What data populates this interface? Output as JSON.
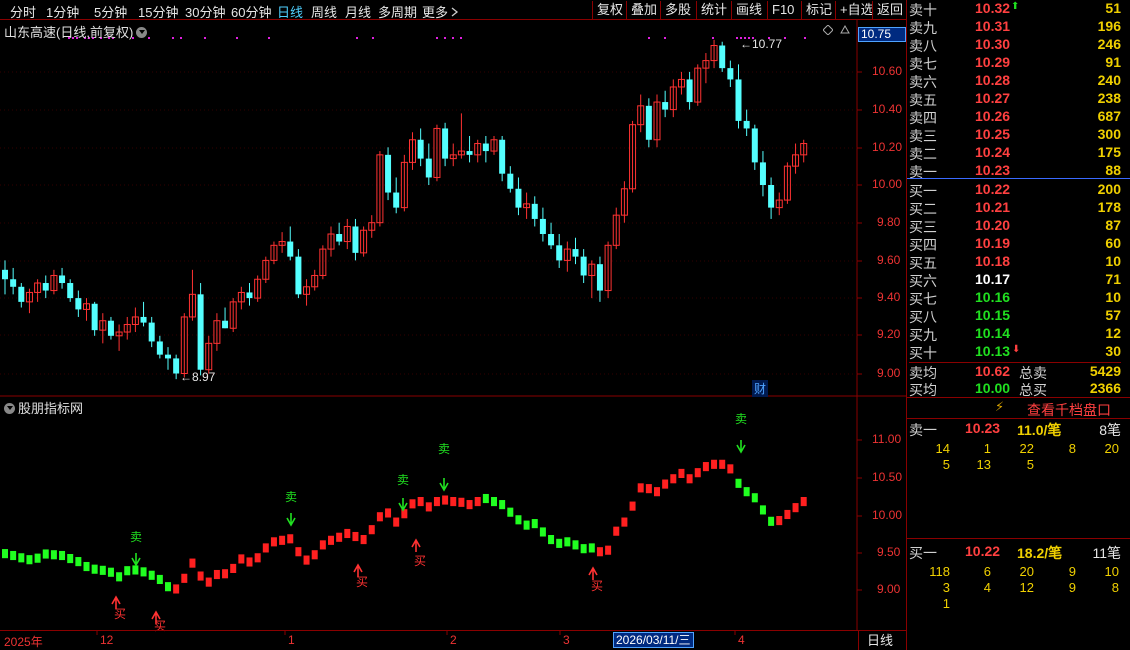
{
  "toolbar": {
    "periods": [
      {
        "label": "分时"
      },
      {
        "label": "1分钟"
      },
      {
        "label": "5分钟"
      },
      {
        "label": "15分钟"
      },
      {
        "label": "30分钟"
      },
      {
        "label": "60分钟"
      },
      {
        "label": "日线",
        "active": true
      },
      {
        "label": "周线"
      },
      {
        "label": "月线"
      },
      {
        "label": "多周期"
      },
      {
        "label": "更多"
      }
    ],
    "more_icon": "chevron-right-icon",
    "right_buttons": [
      {
        "label": "复权"
      },
      {
        "label": "叠加"
      },
      {
        "label": "多股"
      },
      {
        "label": "统计"
      },
      {
        "label": "画线"
      },
      {
        "label": "F10"
      },
      {
        "label": "标记"
      },
      {
        "label": "+自选"
      },
      {
        "label": "返回"
      }
    ]
  },
  "main_chart": {
    "title": "山东高速(日线,前复权)",
    "current_price_tag": "10.75",
    "y_ticks": [
      "10.60",
      "10.40",
      "10.20",
      "10.00",
      "9.80",
      "9.60",
      "9.40",
      "9.20",
      "9.00"
    ],
    "high_annotation": "10.77",
    "low_annotation": "8.97",
    "fin_marker": "财",
    "diamond_icon": "diamond-icon"
  },
  "indicator": {
    "title": "股朋指标网",
    "y_ticks": [
      "11.00",
      "10.50",
      "10.00",
      "9.50",
      "9.00"
    ],
    "sell_label": "卖",
    "buy_label": "买"
  },
  "date_axis": {
    "labels": [
      "2025年",
      "12",
      "1",
      "2",
      "3",
      "4"
    ],
    "highlight": "2026/03/11/三",
    "period": "日线"
  },
  "orderbook": {
    "asks": [
      {
        "label": "卖十",
        "price": "10.32",
        "vol": "51"
      },
      {
        "label": "卖九",
        "price": "10.31",
        "vol": "196"
      },
      {
        "label": "卖八",
        "price": "10.30",
        "vol": "246"
      },
      {
        "label": "卖七",
        "price": "10.29",
        "vol": "91"
      },
      {
        "label": "卖六",
        "price": "10.28",
        "vol": "240"
      },
      {
        "label": "卖五",
        "price": "10.27",
        "vol": "238"
      },
      {
        "label": "卖四",
        "price": "10.26",
        "vol": "687"
      },
      {
        "label": "卖三",
        "price": "10.25",
        "vol": "300"
      },
      {
        "label": "卖二",
        "price": "10.24",
        "vol": "175"
      },
      {
        "label": "卖一",
        "price": "10.23",
        "vol": "88"
      }
    ],
    "bids": [
      {
        "label": "买一",
        "price": "10.22",
        "vol": "200"
      },
      {
        "label": "买二",
        "price": "10.21",
        "vol": "178"
      },
      {
        "label": "买三",
        "price": "10.20",
        "vol": "87"
      },
      {
        "label": "买四",
        "price": "10.19",
        "vol": "60"
      },
      {
        "label": "买五",
        "price": "10.18",
        "vol": "10"
      },
      {
        "label": "买六",
        "price": "10.17",
        "vol": "71"
      },
      {
        "label": "买七",
        "price": "10.16",
        "vol": "10"
      },
      {
        "label": "买八",
        "price": "10.15",
        "vol": "57"
      },
      {
        "label": "买九",
        "price": "10.14",
        "vol": "12"
      },
      {
        "label": "买十",
        "price": "10.13",
        "vol": "30"
      }
    ],
    "avg_sell": {
      "label": "卖均",
      "price": "10.62",
      "total_label": "总卖",
      "total": "5429"
    },
    "avg_buy": {
      "label": "买均",
      "price": "10.00",
      "total_label": "总买",
      "total": "2366"
    },
    "view_button": "查看千档盘口",
    "sell1_detail": {
      "label": "卖一",
      "price": "10.23",
      "per": "11.0/笔",
      "count": "8笔",
      "rows": [
        [
          "14",
          "1",
          "22",
          "8",
          "20"
        ],
        [
          "5",
          "13",
          "5",
          "",
          ""
        ]
      ]
    },
    "buy1_detail": {
      "label": "买一",
      "price": "10.22",
      "per": "18.2/笔",
      "count": "11笔",
      "rows": [
        [
          "118",
          "6",
          "20",
          "9",
          "10"
        ],
        [
          "3",
          "4",
          "12",
          "9",
          "8"
        ],
        [
          "1",
          "",
          "",
          "",
          ""
        ]
      ]
    }
  },
  "colors": {
    "up": "#ff3232",
    "down": "#54ffff",
    "ind_up": "#ff2020",
    "ind_down": "#20ff20",
    "grid": "#8a0000",
    "yellow": "#f0d000"
  }
}
